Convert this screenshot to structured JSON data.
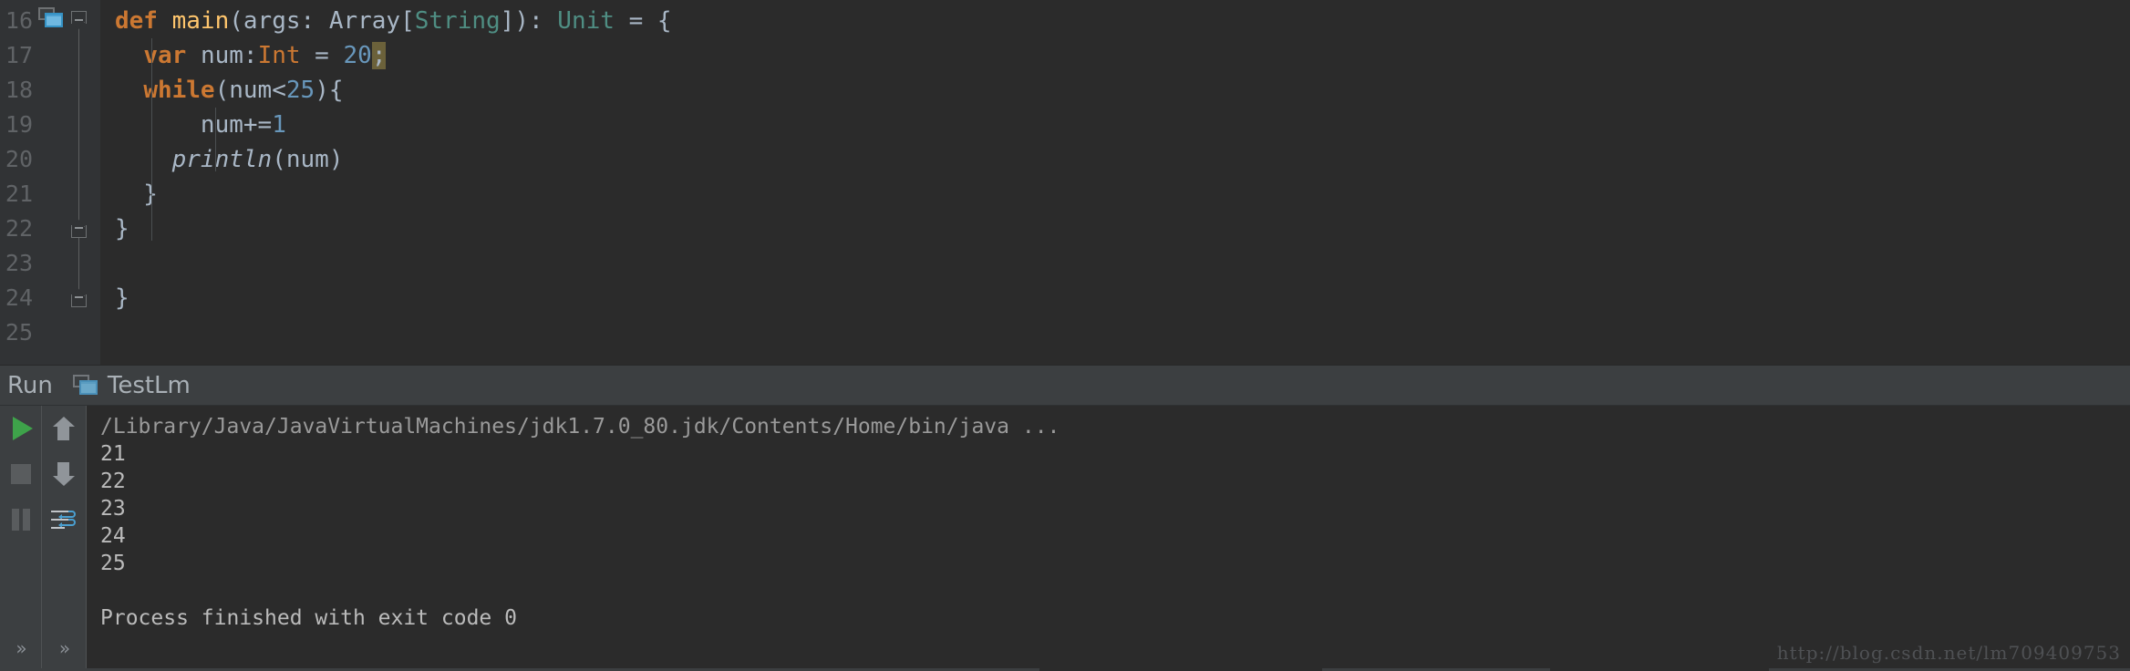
{
  "editor": {
    "theme_bg": "#2b2b2b",
    "gutter_bg": "#313335",
    "line_numbers": [
      "16",
      "17",
      "18",
      "19",
      "20",
      "21",
      "22",
      "23",
      "24",
      "25"
    ],
    "lines": [
      {
        "num": "16",
        "indent": 0,
        "tokens": [
          {
            "t": "def ",
            "c": "kw"
          },
          {
            "t": "main",
            "c": "fn"
          },
          {
            "t": "(args: Array[",
            "c": "pln"
          },
          {
            "t": "String",
            "c": "type"
          },
          {
            "t": "]): ",
            "c": "pln"
          },
          {
            "t": "Unit",
            "c": "type"
          },
          {
            "t": " = {",
            "c": "pln"
          }
        ]
      },
      {
        "num": "17",
        "indent": 1,
        "tokens": [
          {
            "t": "  ",
            "c": "pln"
          },
          {
            "t": "var ",
            "c": "kw"
          },
          {
            "t": "num:",
            "c": "pln"
          },
          {
            "t": "Int",
            "c": "typ2"
          },
          {
            "t": " = ",
            "c": "pln"
          },
          {
            "t": "20",
            "c": "num"
          },
          {
            "t": ";",
            "c": "pln warnhl"
          }
        ]
      },
      {
        "num": "18",
        "indent": 1,
        "tokens": [
          {
            "t": "  ",
            "c": "pln"
          },
          {
            "t": "while",
            "c": "kw"
          },
          {
            "t": "(num<",
            "c": "pln"
          },
          {
            "t": "25",
            "c": "num"
          },
          {
            "t": "){",
            "c": "pln"
          }
        ]
      },
      {
        "num": "19",
        "indent": 2,
        "tokens": [
          {
            "t": "      num+=",
            "c": "pln"
          },
          {
            "t": "1",
            "c": "num"
          }
        ]
      },
      {
        "num": "20",
        "indent": 2,
        "tokens": [
          {
            "t": "    ",
            "c": "pln"
          },
          {
            "t": "println",
            "c": "ital"
          },
          {
            "t": "(num)",
            "c": "pln"
          }
        ]
      },
      {
        "num": "21",
        "indent": 1,
        "tokens": [
          {
            "t": "  }",
            "c": "brc"
          }
        ]
      },
      {
        "num": "22",
        "indent": 0,
        "tokens": [
          {
            "t": "}",
            "c": "brc"
          }
        ]
      },
      {
        "num": "23",
        "indent": 0,
        "tokens": []
      },
      {
        "num": "24",
        "indent": 0,
        "tokens": [
          {
            "t": "}",
            "c": "brc"
          }
        ]
      },
      {
        "num": "25",
        "indent": 0,
        "tokens": []
      }
    ],
    "gutter_icons": {
      "run_configuration_line": "16",
      "run_icon_name": "run-configuration-icon",
      "fold_markers": [
        {
          "line": "16",
          "type": "collapse-down"
        },
        {
          "line": "22",
          "type": "collapse-up"
        },
        {
          "line": "24",
          "type": "collapse-up"
        }
      ]
    }
  },
  "run_window": {
    "header": {
      "title": "Run",
      "tab_label": "TestLm",
      "tab_icon": "run-configuration-icon"
    },
    "toolbar_primary": [
      {
        "name": "rerun-button",
        "icon": "play-icon",
        "color": "#3ea34a"
      },
      {
        "name": "stop-button",
        "icon": "stop-icon",
        "color": "#595c5e"
      },
      {
        "name": "pause-button",
        "icon": "pause-icon",
        "color": "#595c5e"
      },
      {
        "name": "toolbar-overflow-button",
        "icon": "chevrons-right-icon",
        "label": "»"
      }
    ],
    "toolbar_secondary": [
      {
        "name": "up-the-stack-trace-button",
        "icon": "arrow-up-icon",
        "color": "#90959a"
      },
      {
        "name": "down-the-stack-trace-button",
        "icon": "arrow-down-icon",
        "color": "#90959a"
      },
      {
        "name": "soft-wrap-button",
        "icon": "soft-wrap-icon",
        "color": "#4a9fd0"
      },
      {
        "name": "toolbar-overflow-button-2",
        "icon": "chevrons-right-icon",
        "label": "»"
      }
    ],
    "console": {
      "command_line": "/Library/Java/JavaVirtualMachines/jdk1.7.0_80.jdk/Contents/Home/bin/java ...",
      "output": [
        "21",
        "22",
        "23",
        "24",
        "25"
      ],
      "blank_line": "",
      "exit_message": "Process finished with exit code 0"
    }
  },
  "watermark": {
    "text": "http://blog.csdn.net/lm709409753"
  },
  "colors": {
    "keyword": "#cc7832",
    "method": "#ffc66d",
    "type": "#4f8e83",
    "number": "#6897bb",
    "plain": "#a9b7c6",
    "warning_highlight": "#6b613a",
    "run_green": "#3ea34a",
    "accent_blue": "#4a9fd0"
  }
}
